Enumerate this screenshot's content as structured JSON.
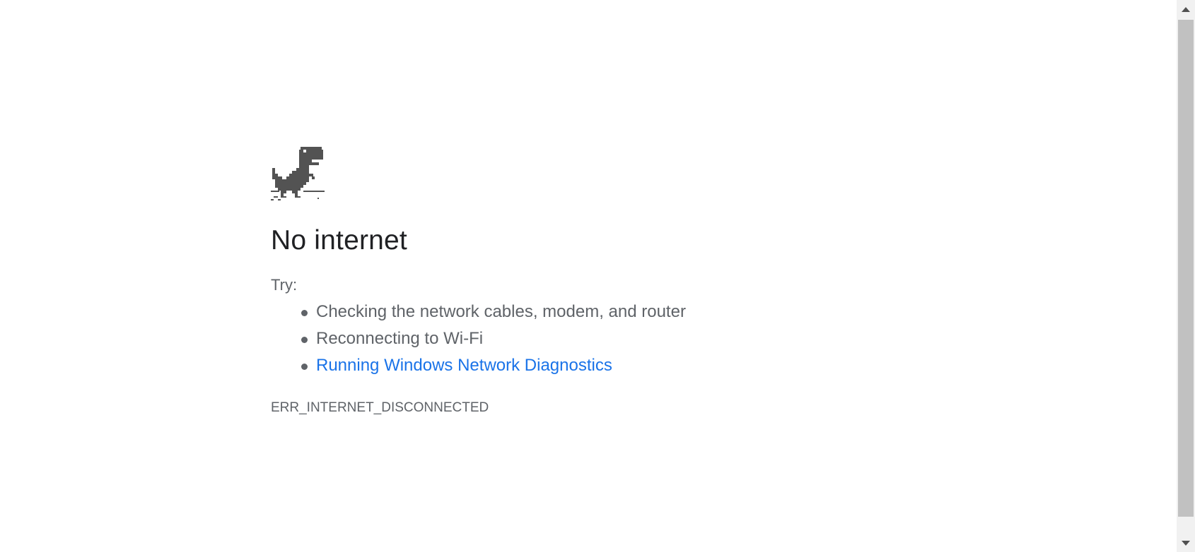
{
  "page": {
    "title": "No internet",
    "try_label": "Try:",
    "suggestions": [
      "Checking the network cables, modem, and router",
      "Reconnecting to Wi-Fi"
    ],
    "diagnostics_link": "Running Windows Network Diagnostics",
    "error_code": "ERR_INTERNET_DISCONNECTED",
    "icon": "offline-dinosaur-icon"
  },
  "colors": {
    "heading": "#202124",
    "body_text": "#5f6368",
    "link": "#1a73e8",
    "icon": "#535353",
    "scrollbar_thumb": "#c1c1c1"
  }
}
